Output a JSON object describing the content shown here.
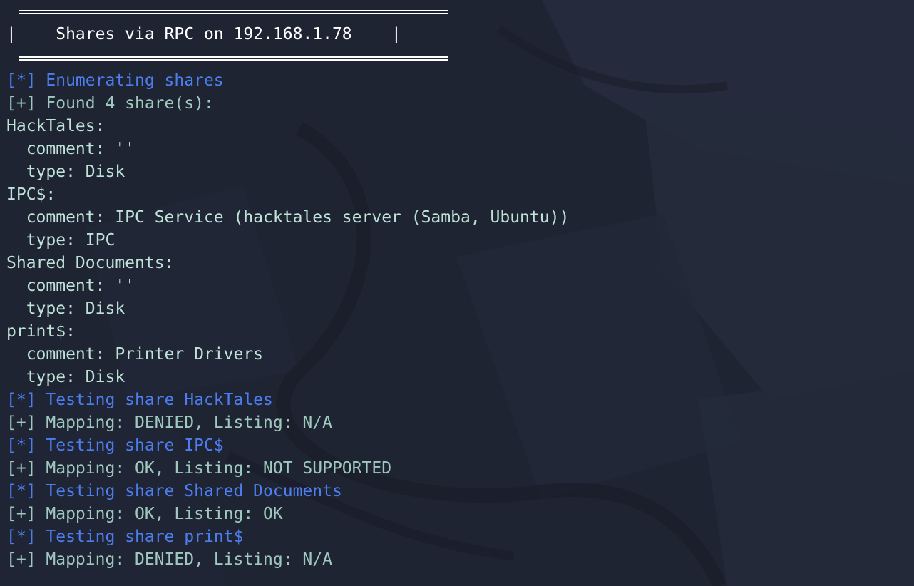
{
  "window": {
    "background": "#1f2433"
  },
  "banner": {
    "text": "|    Shares via RPC on 192.168.1.78    |",
    "color": "#ffffff"
  },
  "output": {
    "colors": {
      "info": "#4d7ef0",
      "success": "#9fc9bf",
      "plain": "#bfe3d8"
    },
    "lines": [
      {
        "style": "info",
        "text": "[*] Enumerating shares"
      },
      {
        "style": "ok",
        "text": "[+] Found 4 share(s):"
      },
      {
        "style": "plain",
        "text": "HackTales:"
      },
      {
        "style": "plain",
        "text": "  comment: ''"
      },
      {
        "style": "plain",
        "text": "  type: Disk"
      },
      {
        "style": "plain",
        "text": "IPC$:"
      },
      {
        "style": "plain",
        "text": "  comment: IPC Service (hacktales server (Samba, Ubuntu))"
      },
      {
        "style": "plain",
        "text": "  type: IPC"
      },
      {
        "style": "plain",
        "text": "Shared Documents:"
      },
      {
        "style": "plain",
        "text": "  comment: ''"
      },
      {
        "style": "plain",
        "text": "  type: Disk"
      },
      {
        "style": "plain",
        "text": "print$:"
      },
      {
        "style": "plain",
        "text": "  comment: Printer Drivers"
      },
      {
        "style": "plain",
        "text": "  type: Disk"
      },
      {
        "style": "info",
        "text": "[*] Testing share HackTales"
      },
      {
        "style": "ok",
        "text": "[+] Mapping: DENIED, Listing: N/A"
      },
      {
        "style": "info",
        "text": "[*] Testing share IPC$"
      },
      {
        "style": "ok",
        "text": "[+] Mapping: OK, Listing: NOT SUPPORTED"
      },
      {
        "style": "info",
        "text": "[*] Testing share Shared Documents"
      },
      {
        "style": "ok",
        "text": "[+] Mapping: OK, Listing: OK"
      },
      {
        "style": "info",
        "text": "[*] Testing share print$"
      },
      {
        "style": "ok",
        "text": "[+] Mapping: DENIED, Listing: N/A"
      }
    ]
  }
}
